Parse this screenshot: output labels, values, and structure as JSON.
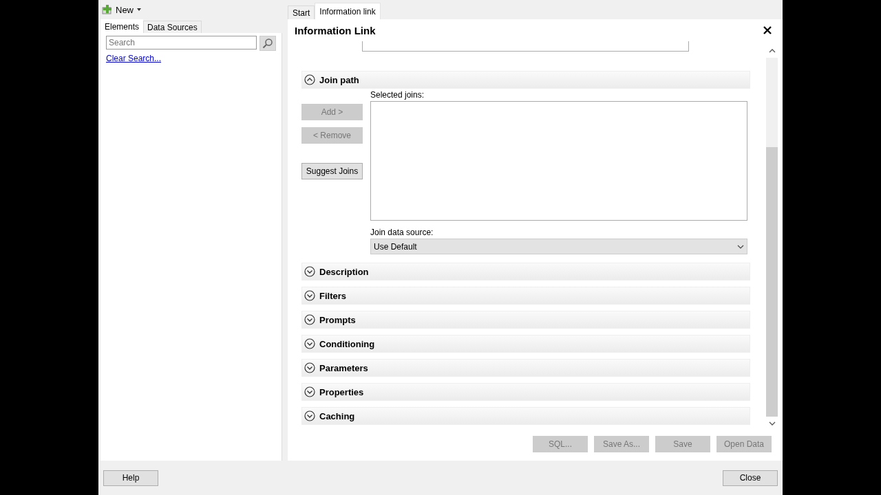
{
  "toolbar": {
    "new_label": "New"
  },
  "left_tabs": [
    {
      "label": "Elements",
      "selected": true
    },
    {
      "label": "Data Sources",
      "selected": false
    }
  ],
  "search": {
    "placeholder": "Search"
  },
  "clear_search": "Clear Search...",
  "tabs": [
    {
      "label": "Start",
      "selected": false
    },
    {
      "label": "Information link",
      "selected": true
    }
  ],
  "panel": {
    "title": "Information Link"
  },
  "join_path": {
    "title": "Join path",
    "expanded": true,
    "buttons": [
      {
        "label": "Add >",
        "disabled": true
      },
      {
        "label": "< Remove",
        "disabled": true
      },
      {
        "label": "Suggest Joins",
        "disabled": false
      }
    ],
    "selected_joins_label": "Selected joins:",
    "join_data_source_label": "Join data source:",
    "join_data_source": "Use Default"
  },
  "sections": [
    {
      "title": "Description",
      "expanded": false
    },
    {
      "title": "Filters",
      "expanded": false
    },
    {
      "title": "Prompts",
      "expanded": false
    },
    {
      "title": "Conditioning",
      "expanded": false
    },
    {
      "title": "Parameters",
      "expanded": false
    },
    {
      "title": "Properties",
      "expanded": false
    },
    {
      "title": "Caching",
      "expanded": false
    }
  ],
  "actions": [
    {
      "label": "SQL...",
      "disabled": true
    },
    {
      "label": "Save As...",
      "disabled": true
    },
    {
      "label": "Save",
      "disabled": true
    },
    {
      "label": "Open Data",
      "disabled": true
    }
  ],
  "footer": {
    "help": "Help",
    "close": "Close"
  }
}
